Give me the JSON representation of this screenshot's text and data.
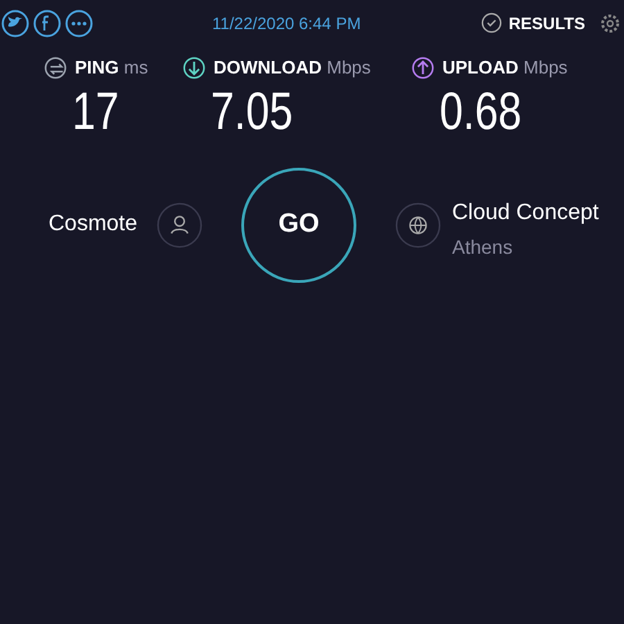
{
  "header": {
    "datetime": "11/22/2020 6:44 PM",
    "results_label": "RESULTS"
  },
  "metrics": [
    {
      "kind": "ping",
      "label": "PING",
      "unit": "ms",
      "value": "17",
      "color": "#9ca3af"
    },
    {
      "kind": "download",
      "label": "DOWNLOAD",
      "unit": "Mbps",
      "value": "7.05",
      "color": "#5ed3c3"
    },
    {
      "kind": "upload",
      "label": "UPLOAD",
      "unit": "Mbps",
      "value": "0.68",
      "color": "#b57cf0"
    }
  ],
  "provider": {
    "name": "Cosmote"
  },
  "go_label": "GO",
  "server": {
    "name": "Cloud Concept",
    "location": "Athens"
  }
}
